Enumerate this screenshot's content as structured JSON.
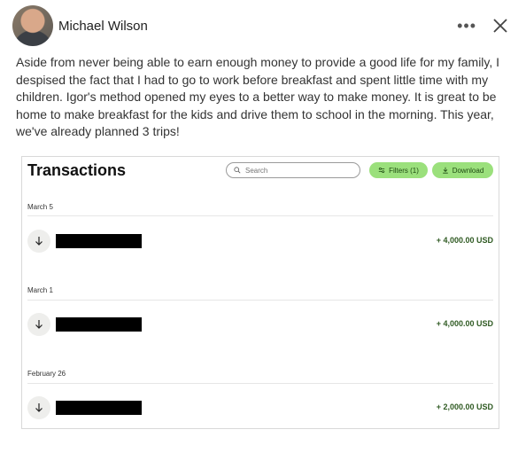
{
  "post": {
    "author": "Michael Wilson",
    "text": "Aside from never being able to earn enough money to provide a good life for my family, I despised the fact that I had to go to work before breakfast and spent little time with my children. Igor's method opened my eyes to a better way to make money. It is great to be home to make breakfast for the kids and drive them to school in the morning. This year, we've already planned 3 trips!",
    "more_icon": "more-horizontal-icon",
    "close_icon": "close-icon"
  },
  "transactions": {
    "title": "Transactions",
    "search_placeholder": "Search",
    "filters_label": "Filters (1)",
    "download_label": "Download",
    "accent_color": "#9be07c",
    "amount_color": "#2f5a22",
    "groups": [
      {
        "date": "March 5",
        "amount": "+ 4,000.00 USD"
      },
      {
        "date": "March 1",
        "amount": "+ 4,000.00 USD"
      },
      {
        "date": "February 26",
        "amount": "+ 2,000.00 USD"
      }
    ]
  }
}
